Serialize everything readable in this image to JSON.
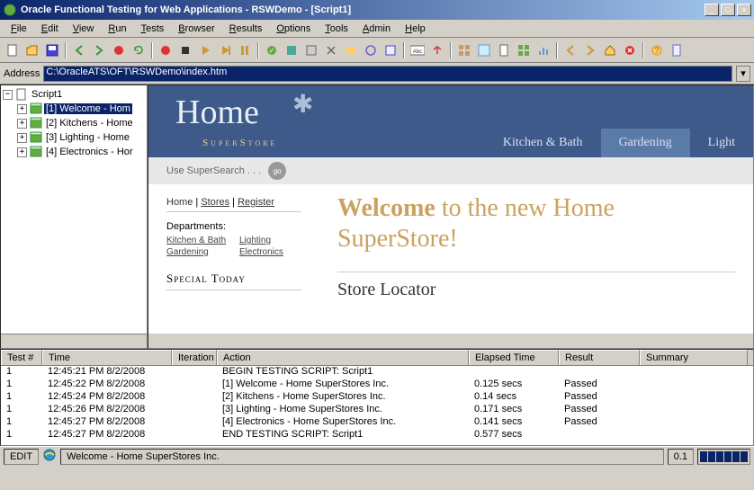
{
  "title": "Oracle Functional Testing for Web Applications - RSWDemo - [Script1]",
  "menus": [
    "File",
    "Edit",
    "View",
    "Run",
    "Tests",
    "Browser",
    "Results",
    "Options",
    "Tools",
    "Admin",
    "Help"
  ],
  "address": {
    "label": "Address",
    "value": "C:\\OracleATS\\OFT\\RSWDemo\\index.htm"
  },
  "tree": {
    "root": "Script1",
    "nodes": [
      {
        "label": "[1] Welcome - Hom",
        "selected": true
      },
      {
        "label": "[2] Kitchens - Home",
        "selected": false
      },
      {
        "label": "[3] Lighting - Home",
        "selected": false
      },
      {
        "label": "[4] Electronics - Hor",
        "selected": false
      }
    ]
  },
  "page": {
    "logo_main": "Home",
    "logo_sub": "SuperStore",
    "nav": [
      "Kitchen & Bath",
      "Gardening",
      "Light"
    ],
    "nav_active_index": 1,
    "search_placeholder": "Use SuperSearch . . .",
    "search_btn": "go",
    "crumbs": [
      "Home",
      "Stores",
      "Register"
    ],
    "departments_title": "Departments:",
    "departments": [
      "Kitchen & Bath",
      "Lighting",
      "Gardening",
      "Electronics"
    ],
    "special_title": "Special Today",
    "welcome_bold": "Welcome",
    "welcome_rest": " to the new Home SuperStore!",
    "locator": "Store Locator"
  },
  "results": {
    "headers": [
      "Test #",
      "Time",
      "Iteration",
      "Action",
      "Elapsed Time",
      "Result",
      "Summary"
    ],
    "rows": [
      {
        "test": "1",
        "time": "12:45:21 PM 8/2/2008",
        "iter": "",
        "action": "BEGIN TESTING SCRIPT: Script1",
        "elapsed": "",
        "result": ""
      },
      {
        "test": "1",
        "time": "12:45:22 PM 8/2/2008",
        "iter": "",
        "action": "[1] Welcome - Home SuperStores Inc.",
        "elapsed": "0.125 secs",
        "result": "Passed"
      },
      {
        "test": "1",
        "time": "12:45:24 PM 8/2/2008",
        "iter": "",
        "action": "[2] Kitchens - Home SuperStores Inc.",
        "elapsed": "0.14 secs",
        "result": "Passed"
      },
      {
        "test": "1",
        "time": "12:45:26 PM 8/2/2008",
        "iter": "",
        "action": "[3] Lighting - Home SuperStores Inc.",
        "elapsed": "0.171 secs",
        "result": "Passed"
      },
      {
        "test": "1",
        "time": "12:45:27 PM 8/2/2008",
        "iter": "",
        "action": "[4] Electronics - Home SuperStores Inc.",
        "elapsed": "0.141 secs",
        "result": "Passed"
      },
      {
        "test": "1",
        "time": "12:45:27 PM 8/2/2008",
        "iter": "",
        "action": "END TESTING SCRIPT: Script1",
        "elapsed": "0.577 secs",
        "result": ""
      }
    ]
  },
  "statusbar": {
    "mode": "EDIT",
    "page": "Welcome - Home SuperStores Inc.",
    "val": "0.1"
  }
}
